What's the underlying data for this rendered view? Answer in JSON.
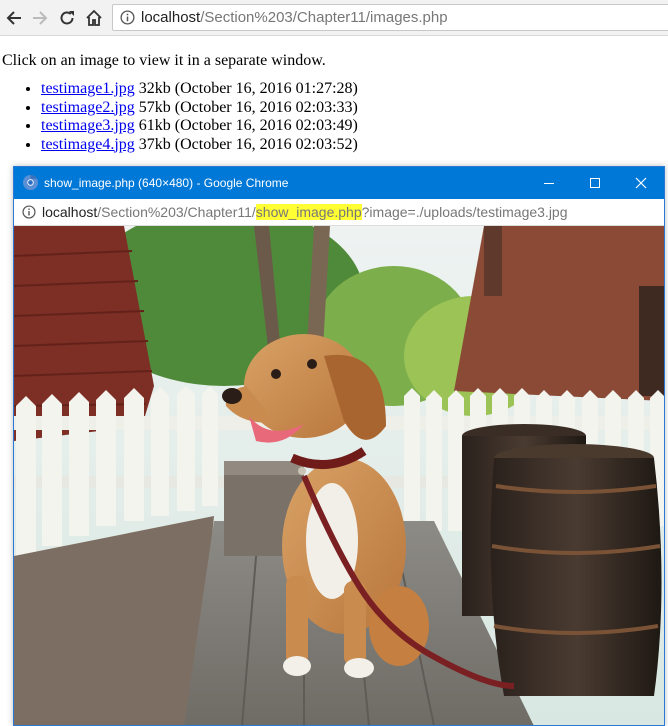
{
  "browser": {
    "url_host": "localhost",
    "url_path": "/Section%203/Chapter11/images.php"
  },
  "page": {
    "intro": "Click on an image to view it in a separate window.",
    "files": [
      {
        "name": "testimage1.jpg",
        "info": " 32kb (October 16, 2016 01:27:28)"
      },
      {
        "name": "testimage2.jpg",
        "info": " 57kb (October 16, 2016 02:03:33)"
      },
      {
        "name": "testimage3.jpg",
        "info": " 61kb (October 16, 2016 02:03:49)"
      },
      {
        "name": "testimage4.jpg",
        "info": " 37kb (October 16, 2016 02:03:52)"
      }
    ]
  },
  "popup": {
    "title": "show_image.php (640×480) - Google Chrome",
    "url_host": "localhost",
    "url_path_before": "/Section%203/Chapter11/",
    "url_highlight": "show_image.php",
    "url_after": "?image=./uploads/testimage3.jpg",
    "highlight_color": "#ffff33",
    "titlebar_color": "#0078d7",
    "image_alt": "testimage3.jpg"
  }
}
